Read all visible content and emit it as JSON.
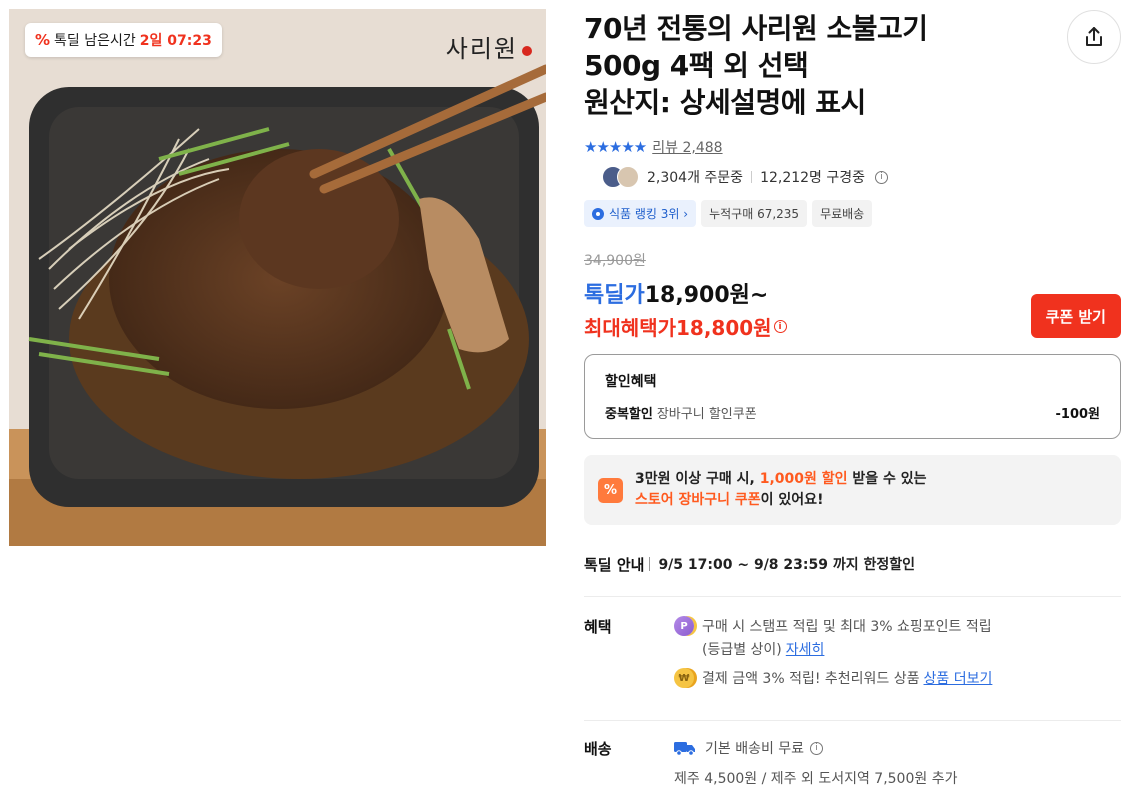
{
  "badge": {
    "percent_symbol": "%",
    "label": "톡딜 남은시간",
    "time": "2일 07:23"
  },
  "brand_logo": "사리원",
  "product": {
    "title_line1": "70년 전통의 사리원 소불고기",
    "title_line2": "500g 4팩 외 선택",
    "title_line3": "원산지: 상세설명에 표시"
  },
  "rating": {
    "stars": "★★★★★",
    "review_text": "리뷰 2,488"
  },
  "stats": {
    "ordering": "2,304개 주문중",
    "watching": "12,212명 구경중"
  },
  "tags": {
    "ranking": "식품 랭킹 3위",
    "cumulative": "누적구매 67,235",
    "shipping": "무료배송"
  },
  "price": {
    "original": "34,900원",
    "deal_label": "톡딜가",
    "deal_value": "18,900원~",
    "max_label": "최대혜택가",
    "max_value": "18,800원",
    "coupon_button": "쿠폰 받기"
  },
  "discount": {
    "title": "할인혜택",
    "row_name": "중복할인",
    "row_desc": "장바구니 할인쿠폰",
    "row_amount": "-100원"
  },
  "cart_coupon": {
    "icon": "%",
    "line1_a": "3만원 이상 구매 시,",
    "line1_hl": "1,000원 할인",
    "line1_b": "받을 수 있는",
    "line2_hl": "스토어 장바구니 쿠폰",
    "line2_b": "이 있어요!"
  },
  "deal_info": {
    "label": "톡딜 안내",
    "value": "9/5 17:00 ~ 9/8 23:59 까지 한정할인"
  },
  "benefits": {
    "label": "혜택",
    "coin_p": "P",
    "line1": "구매 시 스탬프 적립 및 최대 3% 쇼핑포인트 적립",
    "line2": "(등급별 상이)",
    "line2_link": "자세히",
    "coin_w": "₩",
    "line3": "결제 금액 3% 적립! 추천리워드 상품",
    "line3_link": "상품 더보기"
  },
  "shipping": {
    "label": "배송",
    "line1": "기본 배송비 무료",
    "line2": "제주 4,500원 / 제주 외 도서지역 7,500원 추가"
  },
  "colors": {
    "accent_blue": "#2c6de0",
    "accent_red": "#f0321e",
    "coupon_orange": "#ff5a1f"
  },
  "icons": {
    "share": "share-icon",
    "info": "info-icon",
    "truck": "truck-icon",
    "ranking": "ranking-icon"
  }
}
